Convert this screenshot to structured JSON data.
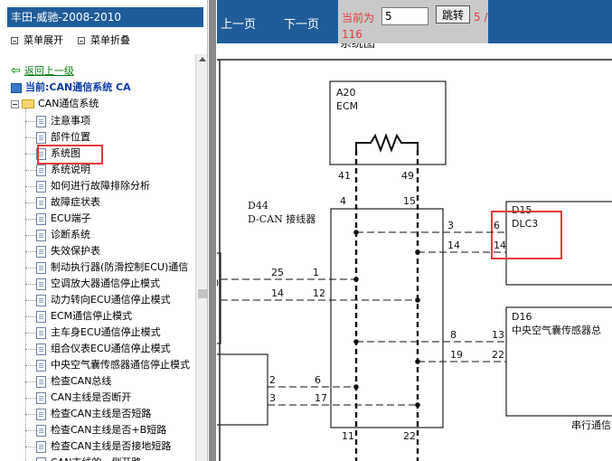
{
  "left_panel": {
    "title": "丰田-威驰-2008-2010",
    "expand_label": "菜单展开",
    "collapse_label": "菜单折叠",
    "back_label": "返回上一级",
    "current_label": "当前:CAN通信系统 CA",
    "root_label": "CAN通信系统",
    "items": [
      {
        "label": "注意事项"
      },
      {
        "label": "部件位置"
      },
      {
        "label": "系统图"
      },
      {
        "label": "系统说明"
      },
      {
        "label": "如何进行故障排除分析"
      },
      {
        "label": "故障症状表"
      },
      {
        "label": "ECU端子"
      },
      {
        "label": "诊断系统"
      },
      {
        "label": "失效保护表"
      },
      {
        "label": "制动执行器(防滑控制ECU)通信"
      },
      {
        "label": "空调放大器通信停止模式"
      },
      {
        "label": "动力转向ECU通信停止模式"
      },
      {
        "label": "ECM通信停止模式"
      },
      {
        "label": "主车身ECU通信停止模式"
      },
      {
        "label": "组合仪表ECU通信停止模式"
      },
      {
        "label": "中央空气囊传感器通信停止模式"
      },
      {
        "label": "检查CAN总线"
      },
      {
        "label": "CAN主线是否断开"
      },
      {
        "label": "检查CAN主线是否短路"
      },
      {
        "label": "检查CAN主线是否+B短路"
      },
      {
        "label": "检查CAN主线是否接地短路"
      },
      {
        "label": "CAN支线的一侧开路"
      }
    ]
  },
  "toolbar": {
    "prev_label": "上一页",
    "next_label": "下一页",
    "current_page_label": "当前为",
    "page_value": "5",
    "jump_label": "跳转",
    "total_label": "5 /",
    "total_pages": "116"
  },
  "diagram": {
    "title_partial": "系统图",
    "ecm_code": "A20",
    "ecm_name": "ECM",
    "connector_code": "D44",
    "connector_name": "D-CAN 接线器",
    "dlc_code": "D15",
    "dlc_name": "DLC3",
    "airbag_code": "D16",
    "airbag_name": "中央空气囊传感器总",
    "serial_label": "串行通信",
    "pins": {
      "ecm_left": "41",
      "ecm_right": "49",
      "conn_top_left": "4",
      "conn_top_right": "15",
      "dlc_in_a": "3",
      "dlc_pin_a": "6",
      "dlc_in_b": "14",
      "dlc_pin_b": "14",
      "left_a_outer": "25",
      "left_a_inner": "1",
      "left_b_outer": "14",
      "left_b_inner": "12",
      "airbag_in_a": "8",
      "airbag_pin_a": "13",
      "airbag_in_b": "19",
      "airbag_pin_b": "22",
      "low_a_outer": "2",
      "low_a_inner": "6",
      "low_b_outer": "3",
      "low_b_inner": "17",
      "bottom_left": "11",
      "bottom_right": "22"
    }
  },
  "colors": {
    "toolbar_bg": "#1f5d9a",
    "highlight": "#e23b3b",
    "back_link": "#0a7a14",
    "current_text": "#0b3aa8"
  }
}
